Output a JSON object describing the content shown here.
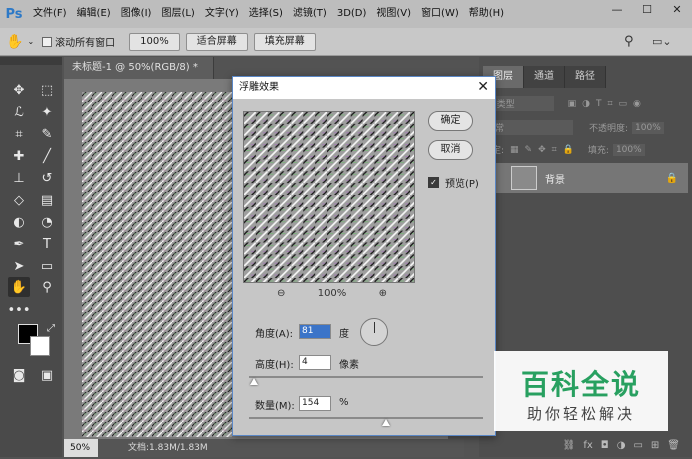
{
  "app": {
    "logo": "Ps",
    "menu": [
      "文件(F)",
      "编辑(E)",
      "图像(I)",
      "图层(L)",
      "文字(Y)",
      "选择(S)",
      "滤镜(T)",
      "3D(D)",
      "视图(V)",
      "窗口(W)",
      "帮助(H)"
    ]
  },
  "options_bar": {
    "scroll_all_label": "滚动所有窗口",
    "zoom_btn": "100%",
    "fit_btn": "适合屏幕",
    "fill_btn": "填充屏幕"
  },
  "document": {
    "tab_title": "未标题-1 @ 50%(RGB/8) *",
    "zoom": "50%",
    "doc_size": "文档:1.83M/1.83M"
  },
  "panel": {
    "tabs": [
      "图层",
      "通道",
      "路径"
    ],
    "kind_label": "类型",
    "blend_mode": "正常",
    "opacity_label": "不透明度:",
    "opacity": "100%",
    "lock_label": "锁定:",
    "fill_label": "填充:",
    "fill": "100%",
    "layer_name": "背景",
    "bottom_fx": "fx"
  },
  "dialog": {
    "title": "浮雕效果",
    "ok": "确定",
    "cancel": "取消",
    "preview_label": "预览(P)",
    "zoom": "100%",
    "angle_label": "角度(A):",
    "angle": "81",
    "angle_unit": "度",
    "height_label": "高度(H):",
    "height": "4",
    "height_unit": "像素",
    "amount_label": "数量(M):",
    "amount": "154",
    "amount_unit": "%",
    "height_slider": 0.02,
    "amount_slider": 0.31
  },
  "watermark": {
    "line1": "百科全说",
    "line2": "助你轻松解决"
  }
}
